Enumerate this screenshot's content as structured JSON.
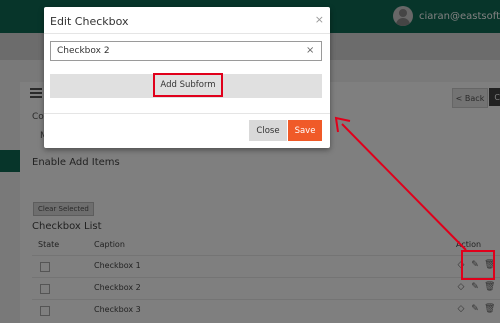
{
  "header": {
    "username": "ciaran@eastsoft",
    "brand_color": "#0f6b55"
  },
  "background": {
    "back_label": "< Back",
    "corner_label": "C",
    "partial_label": "Co",
    "partial_label2": "M",
    "enable_add_items": "Enable Add Items",
    "clear_selected": "Clear Selected",
    "checkbox_list_title": "Checkbox List",
    "table": {
      "headers": {
        "state": "State",
        "caption": "Caption",
        "action": "Action"
      },
      "rows": [
        {
          "caption": "Checkbox 1"
        },
        {
          "caption": "Checkbox 2"
        },
        {
          "caption": "Checkbox 3"
        }
      ],
      "action_icons": [
        "tag-icon",
        "edit-icon",
        "trash-icon"
      ]
    }
  },
  "modal": {
    "title": "Edit Checkbox",
    "caption_value": "Checkbox 2",
    "add_subform_label": "Add Subform",
    "close_label": "Close",
    "save_label": "Save",
    "save_color": "#f05a28"
  },
  "annotation": {
    "color": "#e0001b"
  }
}
